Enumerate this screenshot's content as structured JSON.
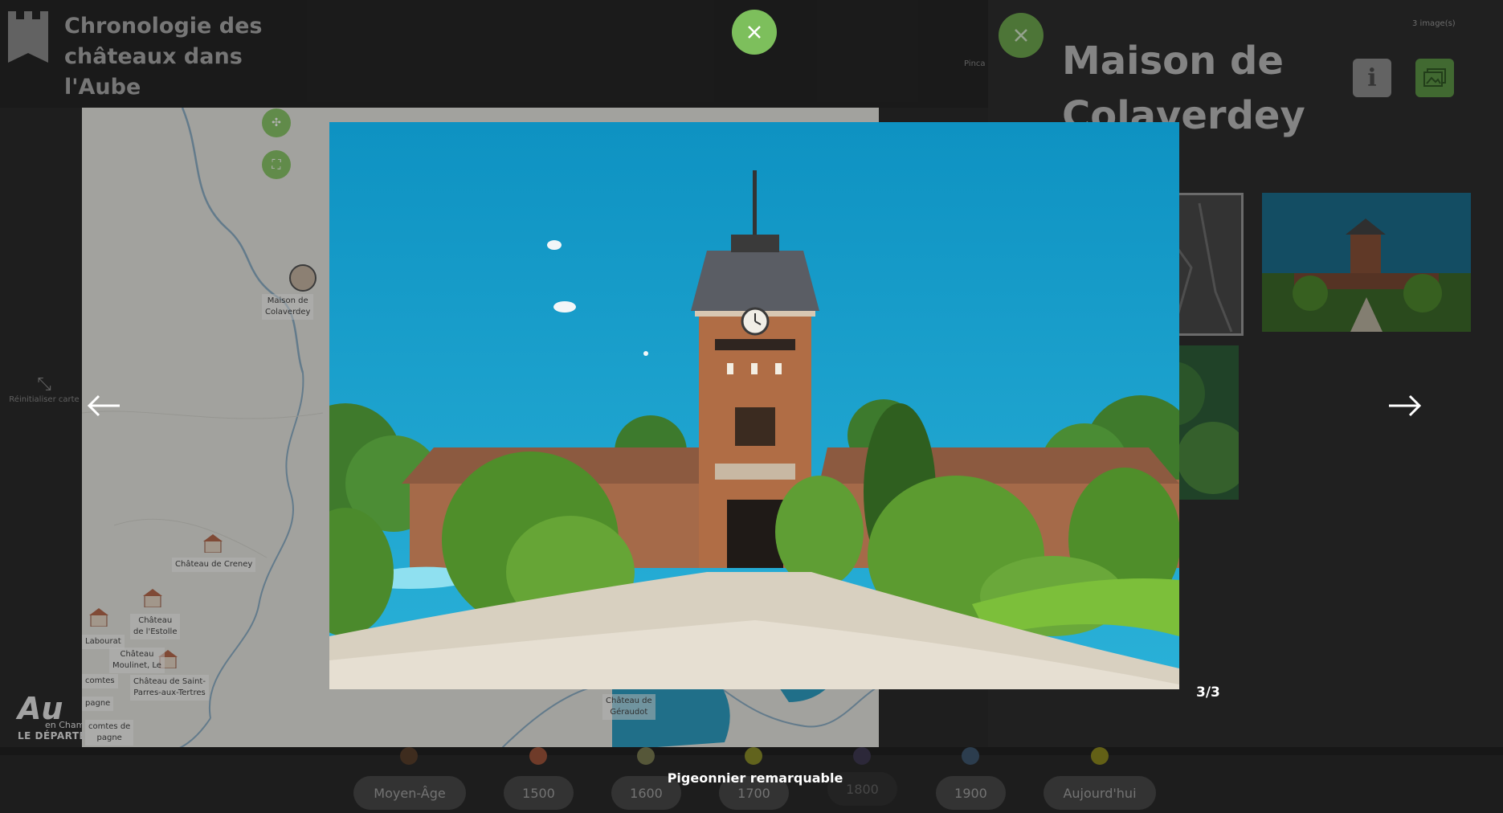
{
  "app": {
    "title_line1": "Chronologie des",
    "title_line2": "châteaux dans l'Aube",
    "reset_map_label": "Réinitialiser carte",
    "department_logo_big": "Au",
    "department_logo_small": "LE DÉPARTE",
    "department_logo_sub": "en Cham"
  },
  "map": {
    "labels": [
      {
        "id": "colaverdey",
        "text1": "Maison de",
        "text2": "Colaverdey"
      },
      {
        "id": "creney",
        "text1": "Château de Creney",
        "text2": ""
      },
      {
        "id": "estolle",
        "text1": "Château",
        "text2": "de l'Estolle"
      },
      {
        "id": "labourat",
        "text1": "Labourat",
        "text2": ""
      },
      {
        "id": "moulinet",
        "text1": "Château",
        "text2": "Moulinet, Le"
      },
      {
        "id": "comtes",
        "text1": "comtes",
        "text2": ""
      },
      {
        "id": "saint-parres",
        "text1": "Château de Saint-",
        "text2": "Parres-aux-Tertres"
      },
      {
        "id": "pagne1",
        "text1": "pagne",
        "text2": ""
      },
      {
        "id": "comtes-de",
        "text1": "comtes de",
        "text2": "pagne"
      },
      {
        "id": "geraudot",
        "text1": "Château de",
        "text2": "Géraudot"
      }
    ]
  },
  "side_panel": {
    "title_line1": "Maison de",
    "title_line2": "Colaverdey",
    "image_count": "3 image(s)",
    "partial_label": "Pinca"
  },
  "timeline": {
    "items": [
      {
        "label": "Moyen-Âge",
        "dot_color": "#5a3f2b"
      },
      {
        "label": "1500",
        "dot_color": "#a0553c"
      },
      {
        "label": "1600",
        "dot_color": "#7c7d52"
      },
      {
        "label": "1700",
        "dot_color": "#8c8f2a"
      },
      {
        "label": "1800",
        "dot_color": "#3f3a52"
      },
      {
        "label": "1900",
        "dot_color": "#3f5870"
      },
      {
        "label": "Aujourd'hui",
        "dot_color": "#8f8a20"
      }
    ]
  },
  "lightbox": {
    "counter": "3/3",
    "caption": "Pigeonnier remarquable",
    "accent": "#7dbf5c"
  }
}
